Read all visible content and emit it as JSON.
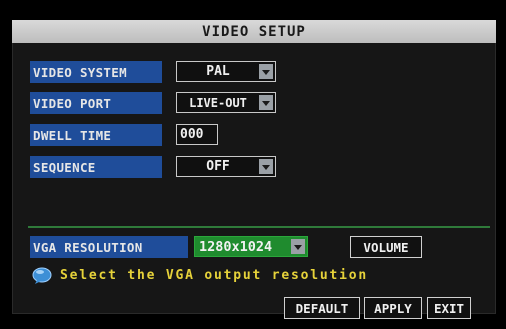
{
  "window": {
    "title": "VIDEO SETUP"
  },
  "settings": {
    "video_system": {
      "label": "VIDEO SYSTEM",
      "value": "PAL"
    },
    "video_port": {
      "label": "VIDEO PORT",
      "value": "LIVE-OUT"
    },
    "dwell_time": {
      "label": "DWELL TIME",
      "value": "000"
    },
    "sequence": {
      "label": "SEQUENCE",
      "value": "OFF"
    }
  },
  "vga": {
    "label": "VGA RESOLUTION",
    "value": "1280x1024",
    "volume_label": "VOLUME"
  },
  "hint": {
    "text": "Select the VGA output resolution",
    "icon": "info-bubble-icon"
  },
  "buttons": {
    "default_label": "DEFAULT",
    "apply_label": "APPLY",
    "exit_label": "EXIT"
  },
  "colors": {
    "label_bg": "#1f4d9a",
    "vga_value_bg": "#1f8b2e",
    "hint_text": "#e6d23a",
    "title_bg": "#d0d0d0",
    "divider": "#2f7a3a"
  }
}
